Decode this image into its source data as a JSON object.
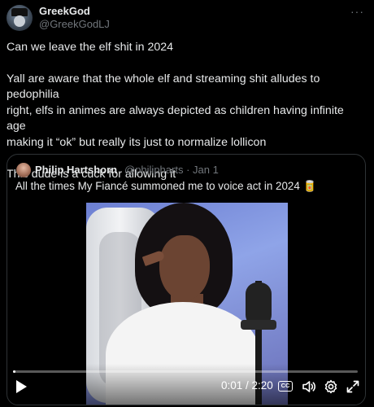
{
  "post": {
    "author_name": "GreekGod",
    "author_handle": "@GreekGodLJ",
    "more_icon": "more-horizontal-icon",
    "body": {
      "line1": "Can we leave the elf shit in 2024",
      "paragraph2_line1": "Yall are aware that the whole elf and streaming shit alludes to pedophilia",
      "paragraph2_line2": "right, elfs in animes are always depicted as children having infinite age",
      "paragraph2_line3": "making it “ok” but really its just to normalize lollicon",
      "line_last": "This dude is a cuck for allowing it"
    }
  },
  "quote": {
    "author_name": "Philip Hartshorn",
    "meta": "@philipharts · Jan 1",
    "text": "All the times My Fiancé summoned me to voice act in 2024 🥫"
  },
  "video": {
    "time": "0:01 / 2:20",
    "progress": 0.0071,
    "cc_label": "CC",
    "icons": [
      "play-icon",
      "captions-icon",
      "volume-icon",
      "settings-icon",
      "fullscreen-icon"
    ]
  },
  "colors": {
    "background": "#000000",
    "text": "#e7e9ea",
    "muted": "#71767b",
    "border": "#2f3336"
  }
}
